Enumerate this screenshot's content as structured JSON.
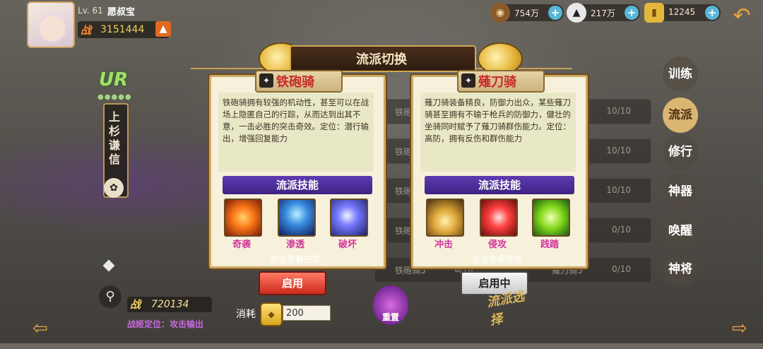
{
  "player": {
    "level": "Lv. 61",
    "name": "愿叔宝",
    "power_label": "战",
    "power": "3151444",
    "power_up_icon": "arrow-up-icon"
  },
  "resources": [
    {
      "icon": "coin-icon",
      "value": "754万",
      "color": "#b07a3a"
    },
    {
      "icon": "rice-ball-icon",
      "value": "217万",
      "color": "#f2f2f2"
    },
    {
      "icon": "gold-ingot-icon",
      "value": "12245",
      "color": "#e3b83a"
    }
  ],
  "hero": {
    "rarity": "UR",
    "name": "上杉谦信",
    "score_label": "战",
    "score": "720134",
    "position": "战姬定位：攻击输出"
  },
  "side_tabs": [
    "训练",
    "流派",
    "修行",
    "神器",
    "唤醒",
    "神将"
  ],
  "side_tabs_active": 1,
  "background_rows": [
    {
      "left": "铁砲",
      "right": "10/10"
    },
    {
      "left": "铁砲",
      "right": "10/10"
    },
    {
      "left": "铁砲",
      "right": "10/10"
    },
    {
      "left": "铁砲",
      "right": "0/10"
    },
    {
      "left": "铁砲骑5",
      "mid": "0/10",
      "right2": "薙刀骑5",
      "right": "0/10"
    }
  ],
  "dialog": {
    "title": "流派切换",
    "cards": [
      {
        "name": "铁砲骑",
        "description": "铁砲骑拥有较强的机动性，甚至可以在战场上隐匿自己的行踪，从而达到出其不意，一击必胜的突击奇效。定位：潜行输出，增强回复能力",
        "skills_header": "流派技能",
        "skills": [
          "奇袭",
          "渗透",
          "破坏"
        ],
        "hint": "点击查看技能",
        "button": "启用"
      },
      {
        "name": "薙刀骑",
        "description": "薙刀骑装备精良，防御力出众，某些薙刀骑甚至拥有不输于枪兵的防御力，健壮的坐骑同时赋予了薙刀骑群伤能力。定位：高防，拥有反伤和群伤能力",
        "skills_header": "流派技能",
        "skills": [
          "冲击",
          "侵攻",
          "践踏"
        ],
        "hint": "点击查看技能",
        "button": "启用中"
      }
    ],
    "cost_label": "消耗",
    "cost_value": "200"
  },
  "reset_label": "重置",
  "seal_text": "流派选择"
}
